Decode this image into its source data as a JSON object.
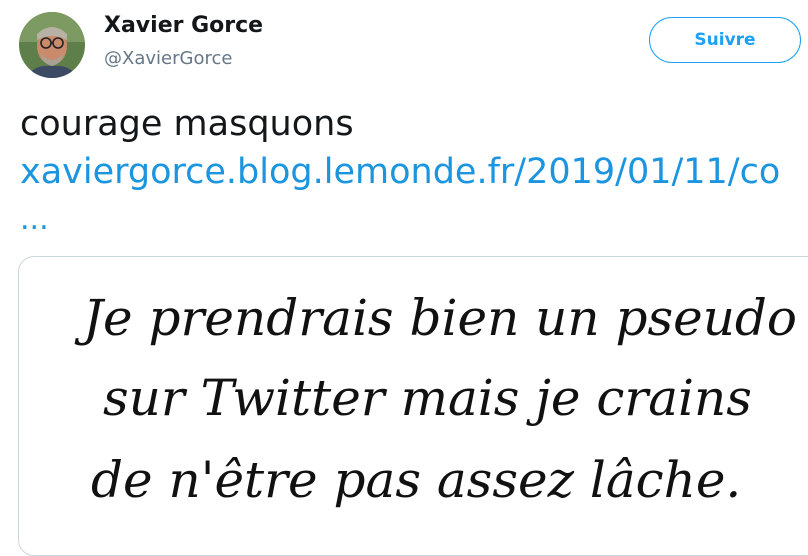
{
  "author": {
    "name": "Xavier Gorce",
    "handle": "@XavierGorce"
  },
  "follow_label": "Suivre",
  "tweet": {
    "text": "courage masquons",
    "link": "xaviergorce.blog.lemonde.fr/2019/01/11/co",
    "ellipsis": "..."
  },
  "media": {
    "handwritten_lines": [
      "Je prendrais bien un pseudo",
      "sur Twitter mais je crains",
      "de n'être pas assez lâche."
    ]
  },
  "colors": {
    "accent": "#1da1f2",
    "link": "#1b95e0",
    "text": "#14171a",
    "muted": "#657786"
  }
}
